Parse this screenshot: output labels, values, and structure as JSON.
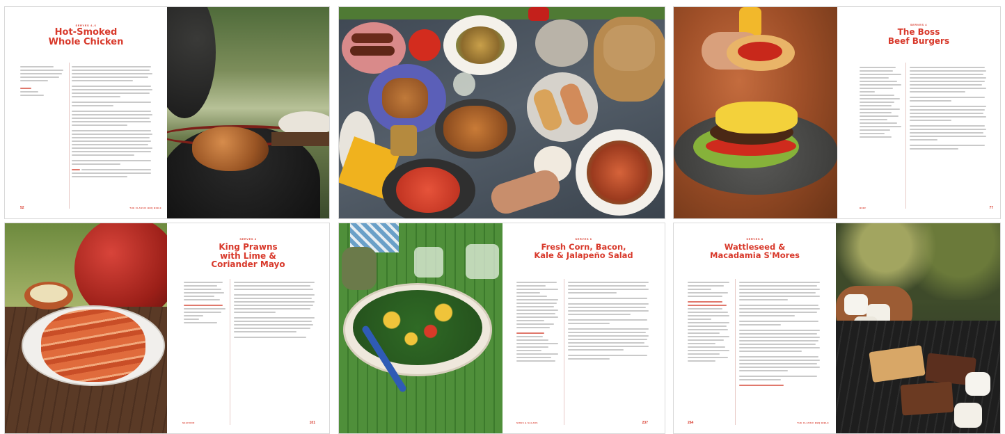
{
  "spreads": [
    {
      "serves": "SERVES 4–6",
      "title": [
        "Hot-Smoked",
        "Whole Chicken"
      ],
      "page_number": "52",
      "footer": "THE CLASSIC BBQ BIBLE"
    },
    {
      "serves": "",
      "title": [],
      "page_number": "",
      "footer": ""
    },
    {
      "serves": "SERVES 4",
      "title": [
        "The Boss",
        "Beef Burgers"
      ],
      "page_number": "77",
      "footer": "BEEF"
    },
    {
      "serves": "SERVES 4",
      "title": [
        "King Prawns",
        "with Lime &",
        "Coriander Mayo"
      ],
      "page_number": "101",
      "footer": "SEAFOOD"
    },
    {
      "serves": "SERVES 6",
      "title": [
        "Fresh Corn, Bacon,",
        "Kale & Jalapeño Salad"
      ],
      "page_number": "237",
      "footer": "SIDES & SALADS"
    },
    {
      "serves": "SERVES 8",
      "title": [
        "Wattleseed &",
        "Macadamia S'Mores"
      ],
      "page_number": "264",
      "footer": "THE CLASSIC BBQ BIBLE"
    }
  ],
  "colors": {
    "accent": "#d8392b",
    "text": "#333333",
    "rule": "#e7c9c5"
  }
}
